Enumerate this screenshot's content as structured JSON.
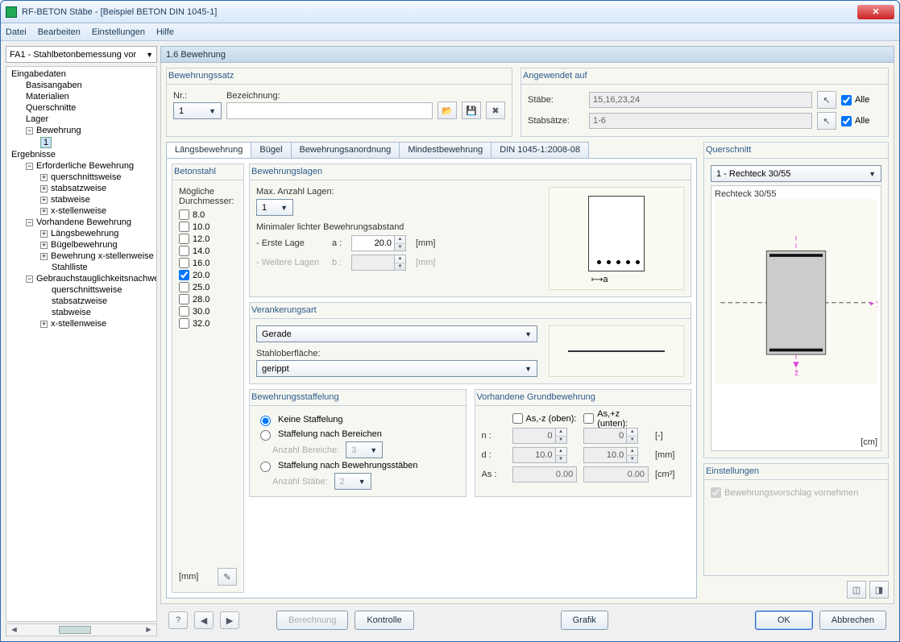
{
  "window": {
    "title": "RF-BETON Stäbe - [Beispiel BETON DIN 1045-1]"
  },
  "menu": {
    "datei": "Datei",
    "bearbeiten": "Bearbeiten",
    "einstellungen": "Einstellungen",
    "hilfe": "Hilfe"
  },
  "case_selector": "FA1 - Stahlbetonbemessung vor",
  "section_header": "1.6 Bewehrung",
  "tree": {
    "eingabedaten": "Eingabedaten",
    "basisangaben": "Basisangaben",
    "materialien": "Materialien",
    "querschnitte": "Querschnitte",
    "lager": "Lager",
    "bewehrung": "Bewehrung",
    "bewehrung_sel": "1",
    "ergebnisse": "Ergebnisse",
    "erf": "Erforderliche Bewehrung",
    "querschnittsweise": "querschnittsweise",
    "stabsatzweise": "stabsatzweise",
    "stabweise": "stabweise",
    "xstellenweise": "x-stellenweise",
    "vorh": "Vorhandene Bewehrung",
    "laengs": "Längsbewehrung",
    "buegel": "Bügelbewehrung",
    "bew_x": "Bewehrung x-stellenweise",
    "stahlliste": "Stahlliste",
    "gebrauch": "Gebrauchstauglichkeitsnachwe"
  },
  "bewehrungssatz": {
    "legend": "Bewehrungssatz",
    "nr_label": "Nr.:",
    "nr_value": "1",
    "bez_label": "Bezeichnung:",
    "bez_value": ""
  },
  "angewendet": {
    "legend": "Angewendet auf",
    "staebe_label": "Stäbe:",
    "staebe_value": "15,16,23,24",
    "stabsaetze_label": "Stabsätze:",
    "stabsaetze_value": "1-6",
    "alle": "Alle"
  },
  "tabs": {
    "t1": "Längsbewehrung",
    "t2": "Bügel",
    "t3": "Bewehrungsanordnung",
    "t4": "Mindestbewehrung",
    "t5": "DIN 1045-1:2008-08"
  },
  "betonstahl": {
    "legend": "Betonstahl",
    "moegliche": "Mögliche Durchmesser:",
    "d": [
      "8.0",
      "10.0",
      "12.0",
      "14.0",
      "16.0",
      "20.0",
      "25.0",
      "28.0",
      "30.0",
      "32.0"
    ],
    "unit": "[mm]"
  },
  "lagen": {
    "legend": "Bewehrungslagen",
    "max_label": "Max. Anzahl Lagen:",
    "max_value": "1",
    "min_label": "Minimaler lichter Bewehrungsabstand",
    "erste": "- Erste Lage",
    "a": "a :",
    "a_val": "20.0",
    "weitere": "- Weitere Lagen",
    "b": "b :",
    "mm": "[mm]",
    "diagram_label": "a"
  },
  "verankerung": {
    "legend": "Verankerungsart",
    "art": "Gerade",
    "ober_label": "Stahloberfläche:",
    "ober_val": "gerippt"
  },
  "staffelung": {
    "legend": "Bewehrungsstaffelung",
    "r1": "Keine Staffelung",
    "r2": "Staffelung nach Bereichen",
    "r2_sub": "Anzahl Bereiche:",
    "r2_val": "3",
    "r3": "Staffelung nach Bewehrungsstäben",
    "r3_sub": "Anzahl Stäbe:",
    "r3_val": "2"
  },
  "grund": {
    "legend": "Vorhandene Grundbewehrung",
    "oben": "As,-z (oben):",
    "unten": "As,+z (unten):",
    "n": "n :",
    "n1": "0",
    "n2": "0",
    "nu": "[-]",
    "d": "d :",
    "d1": "10.0",
    "d2": "10.0",
    "du": "[mm]",
    "As": "As :",
    "As1": "0.00",
    "As2": "0.00",
    "Asu": "[cm²]"
  },
  "querschnitt": {
    "legend": "Querschnitt",
    "sel": "1 - Rechteck 30/55",
    "name": "Rechteck 30/55",
    "unit": "[cm]"
  },
  "einstellungen": {
    "legend": "Einstellungen",
    "vorschlag": "Bewehrungsvorschlag vornehmen"
  },
  "footer": {
    "berechnung": "Berechnung",
    "kontrolle": "Kontrolle",
    "grafik": "Grafik",
    "ok": "OK",
    "abbrechen": "Abbrechen"
  }
}
